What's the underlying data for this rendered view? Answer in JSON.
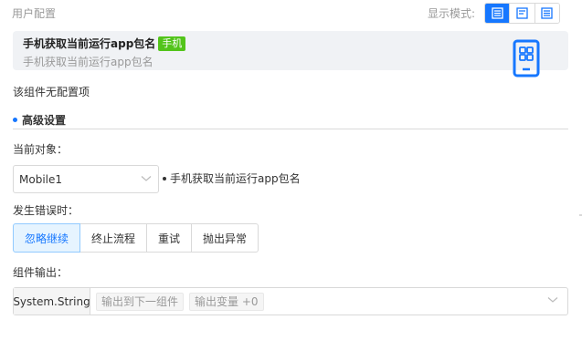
{
  "header": {
    "section_label": "用户配置",
    "display_mode_label": "显示模式:",
    "modes": [
      "mode-1-icon",
      "mode-2-icon",
      "mode-3-icon"
    ],
    "active_mode": 0
  },
  "component": {
    "title": "手机获取当前运行app包名",
    "tag": "手机",
    "subtitle": "手机获取当前运行app包名",
    "icon": "phone-icon"
  },
  "config": {
    "no_config_text": "该组件无配置项"
  },
  "advanced": {
    "title": "高级设置",
    "target_label": "当前对象：",
    "target_value": "Mobile1",
    "target_description": "手机获取当前运行app包名",
    "error_label": "发生错误时：",
    "error_options": [
      "忽略继续",
      "终止流程",
      "重试",
      "抛出异常"
    ],
    "error_selected": "忽略继续",
    "output_label": "组件输出：",
    "output_type": "System.String",
    "output_tags": [
      "输出到下一组件",
      "输出变量 +0"
    ]
  },
  "colors": {
    "accent": "#1677ff",
    "tag_green": "#52c41a",
    "card_bg": "#f0f2f5"
  }
}
